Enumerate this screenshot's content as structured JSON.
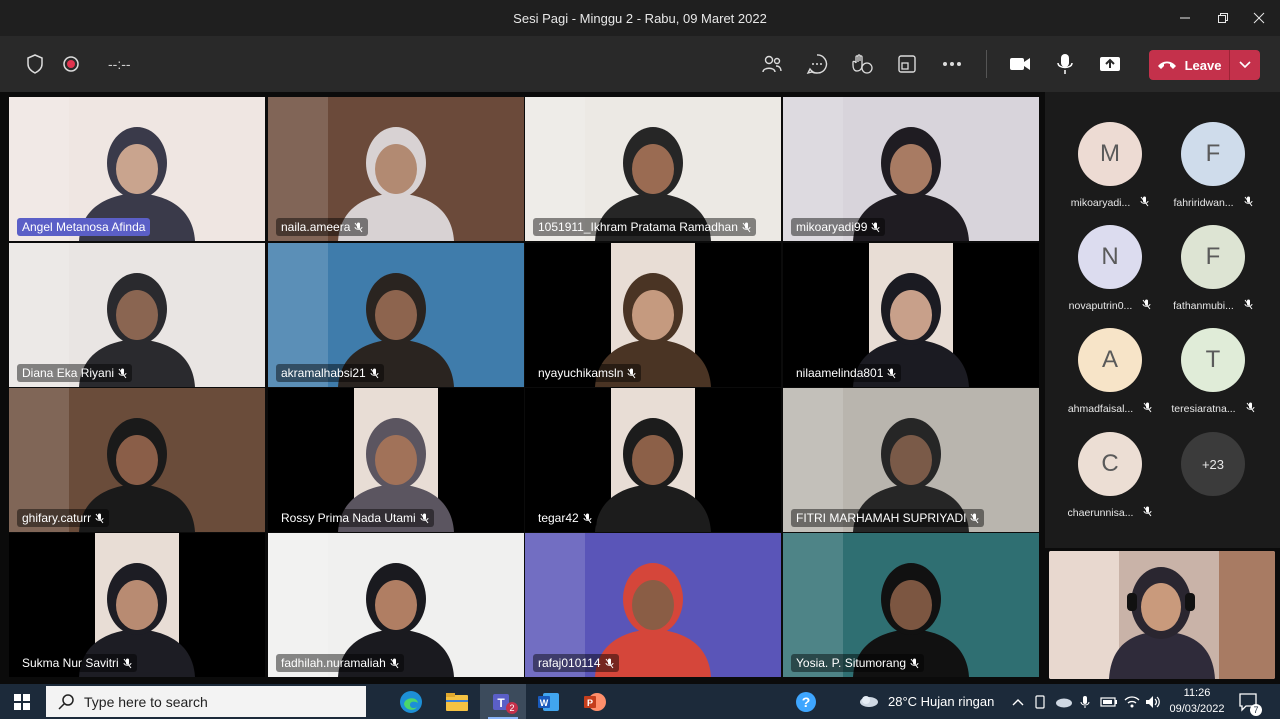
{
  "window": {
    "title": "Sesi Pagi - Minggu 2 - Rabu, 09 Maret 2022"
  },
  "toolbar": {
    "timer": "--:--",
    "leave_label": "Leave"
  },
  "tiles": [
    {
      "name": "Angel Metanosa Afinda",
      "highlight": true,
      "mic": false
    },
    {
      "name": "naila.ameera",
      "mic": true
    },
    {
      "name": "1051911_Ikhram Pratama Ramadhan",
      "mic": true
    },
    {
      "name": "mikoaryadi99",
      "mic": true
    },
    {
      "name": "Diana Eka Riyani",
      "mic": true
    },
    {
      "name": "akramalhabsi21",
      "mic": true
    },
    {
      "name": "nyayuchikamsln",
      "mic": true
    },
    {
      "name": "nilaamelinda801",
      "mic": true
    },
    {
      "name": "ghifary.caturr",
      "mic": true
    },
    {
      "name": "Rossy Prima Nada Utami",
      "mic": true
    },
    {
      "name": "tegar42",
      "mic": true
    },
    {
      "name": "FITRI MARHAMAH SUPRIYADI",
      "mic": true
    },
    {
      "name": "Sukma Nur Savitri",
      "mic": true
    },
    {
      "name": "fadhilah.nuramaliah",
      "mic": true
    },
    {
      "name": "rafaj010114",
      "mic": true
    },
    {
      "name": "Yosia. P. Situmorang",
      "mic": true
    }
  ],
  "roster": [
    {
      "initial": "M",
      "name": "mikoaryadi...",
      "color": "#eddbd3"
    },
    {
      "initial": "F",
      "name": "fahriridwan...",
      "color": "#cfdceb"
    },
    {
      "initial": "N",
      "name": "novaputrin0...",
      "color": "#dcdcef"
    },
    {
      "initial": "F",
      "name": "fathanmubi...",
      "color": "#dde4d3"
    },
    {
      "initial": "A",
      "name": "ahmadfaisal...",
      "color": "#f7e4c8"
    },
    {
      "initial": "T",
      "name": "teresiaratna...",
      "color": "#e0ecd8"
    },
    {
      "initial": "C",
      "name": "chaerunnisa...",
      "color": "#ecded4"
    }
  ],
  "roster_more": "+23",
  "taskbar": {
    "search_placeholder": "Type here to search",
    "teams_badge": "2",
    "weather": "28°C  Hujan ringan",
    "time": "11:26",
    "date": "09/03/2022",
    "notification_count": "7"
  }
}
